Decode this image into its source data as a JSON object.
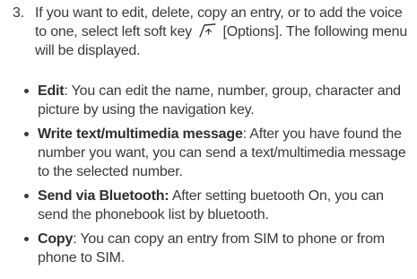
{
  "step": {
    "number": "3.",
    "text_before_icon": "If you want to edit, delete, copy an entry, or to add the voice to one, select left soft key",
    "icon": "left-soft-key-icon",
    "text_after_icon": "[Options]. The following menu will be displayed."
  },
  "items": [
    {
      "term": "Edit",
      "separator": ": ",
      "desc": "You can edit the name, number, group, character and picture by using the navigation key."
    },
    {
      "term": "Write text/multimedia message",
      "separator": ": ",
      "desc": "After you have found the number you want, you can send a text/multimedia message to the selected number."
    },
    {
      "term": "Send via Bluetooth:",
      "separator": " ",
      "desc": "After setting buetooth On, you can send the phonebook list by bluetooth."
    },
    {
      "term": "Copy",
      "separator": ": ",
      "desc": "You can copy an entry from SIM to phone or from phone to SIM."
    }
  ]
}
